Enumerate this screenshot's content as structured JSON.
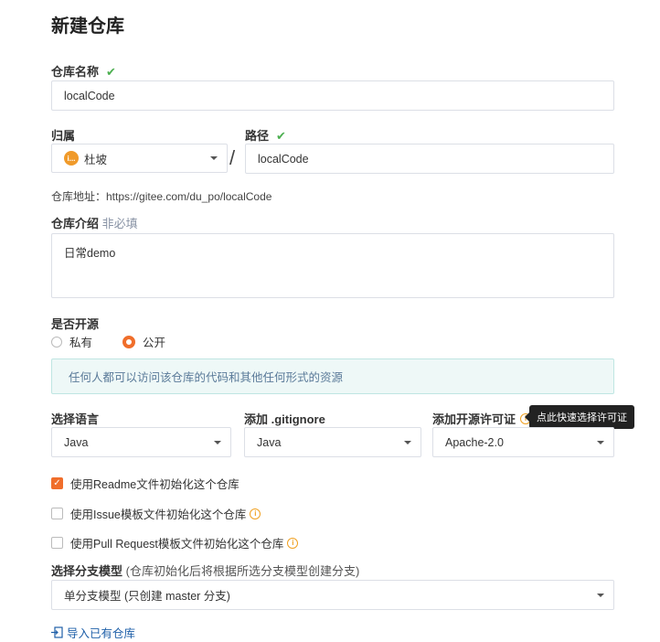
{
  "page": {
    "title": "新建仓库"
  },
  "repo_name": {
    "label": "仓库名称",
    "check": "✔",
    "value": "localCode"
  },
  "owner": {
    "label": "归属",
    "avatar_text": "i...",
    "value": "杜坡"
  },
  "separator": "/",
  "path": {
    "label": "路径",
    "check": "✔",
    "value": "localCode"
  },
  "repo_address": {
    "text": "仓库地址：https://gitee.com/du_po/localCode"
  },
  "description": {
    "label": "仓库介绍",
    "optional": "非必填",
    "value": "日常demo"
  },
  "open_source": {
    "label": "是否开源",
    "options": [
      {
        "label": "私有",
        "selected": false
      },
      {
        "label": "公开",
        "selected": true
      }
    ],
    "info": "任何人都可以访问该仓库的代码和其他任何形式的资源"
  },
  "language": {
    "label": "选择语言",
    "value": "Java"
  },
  "gitignore": {
    "label": "添加 .gitignore",
    "value": "Java"
  },
  "license": {
    "label": "添加开源许可证",
    "value": "Apache-2.0",
    "tooltip": "点此快速选择许可证"
  },
  "init_options": [
    {
      "label": "使用Readme文件初始化这个仓库",
      "checked": true,
      "info": false
    },
    {
      "label": "使用Issue模板文件初始化这个仓库",
      "checked": false,
      "info": true
    },
    {
      "label": "使用Pull Request模板文件初始化这个仓库",
      "checked": false,
      "info": true
    }
  ],
  "branch_model": {
    "label": "选择分支模型",
    "hint": "(仓库初始化后将根据所选分支模型创建分支)",
    "value": "单分支模型 (只创建 master 分支)"
  },
  "import_link": {
    "icon": "import-icon",
    "label": "导入已有仓库"
  },
  "colors": {
    "accent": "#f06e2b",
    "check": "#4caf50",
    "link": "#1e5fa8",
    "info_bg": "#eef8f7"
  }
}
